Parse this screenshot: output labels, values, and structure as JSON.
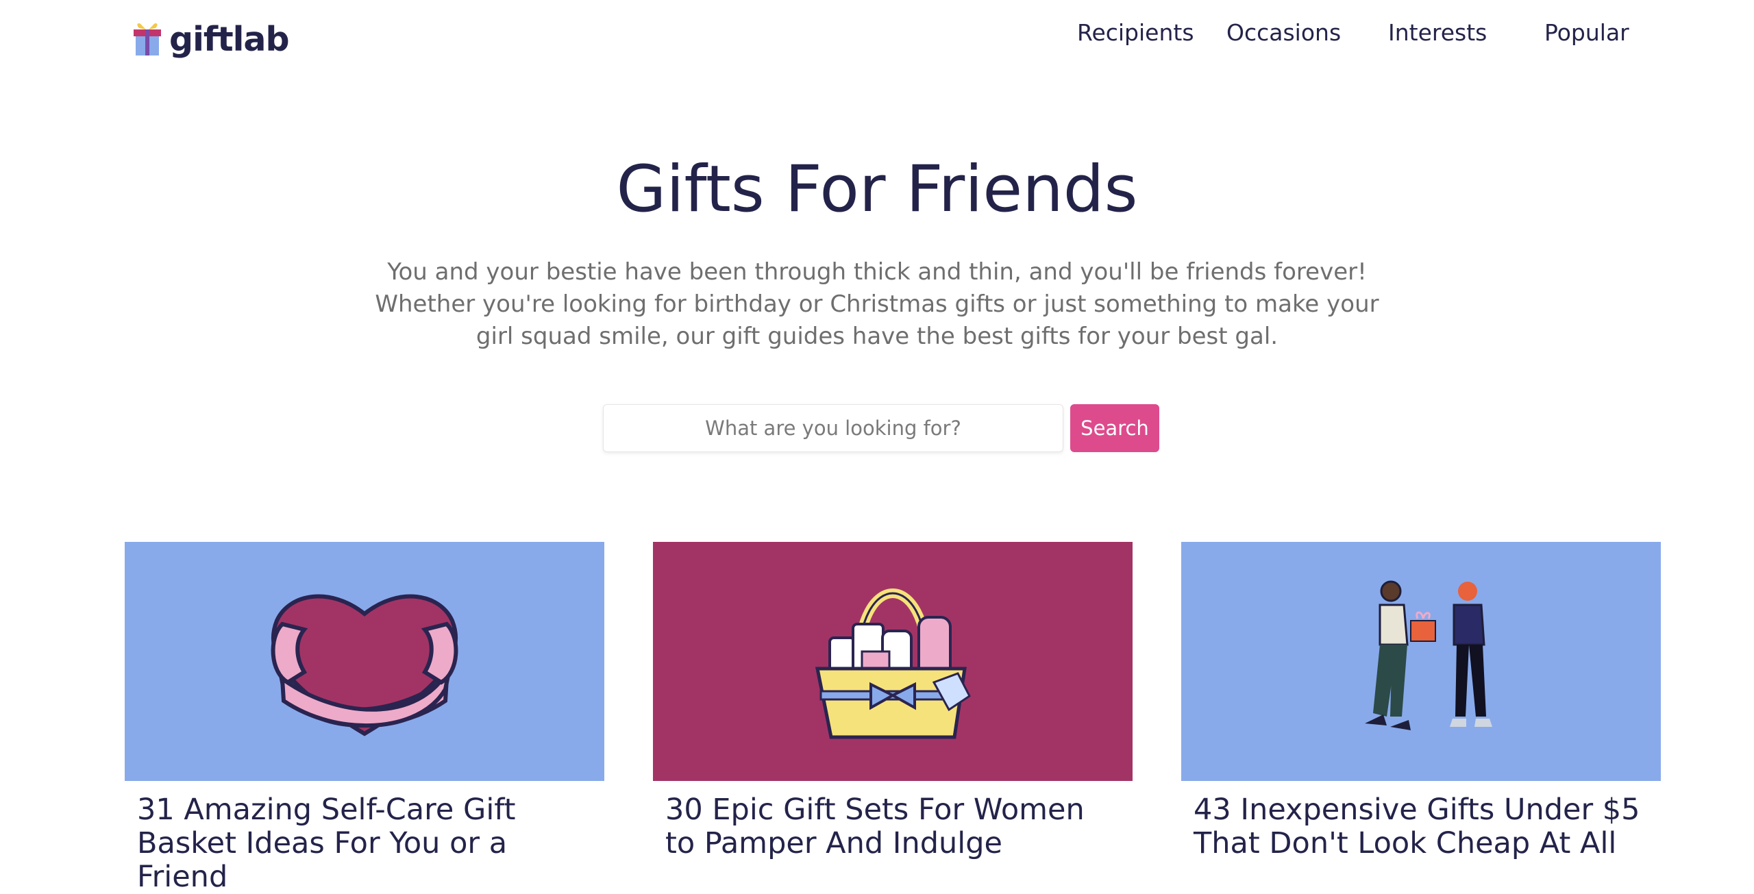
{
  "header": {
    "logo_text": "giftlab",
    "nav": {
      "recipients": "Recipients",
      "occasions": "Occasions",
      "interests": "Interests",
      "popular": "Popular"
    }
  },
  "hero": {
    "title": "Gifts For Friends",
    "description": "You and your bestie have been through thick and thin, and you'll be friends forever! Whether you're looking for birthday or Christmas gifts or just something to make your girl squad smile, our gift guides have the best gifts for your best gal."
  },
  "search": {
    "placeholder": "What are you looking for?",
    "button_label": "Search"
  },
  "cards": [
    {
      "title": "31 Amazing Self-Care Gift Basket Ideas For You or a Friend",
      "image": "heart-hug-icon",
      "bg_color": "#88aaeb"
    },
    {
      "title": "30 Epic Gift Sets For Women to Pamper And Indulge",
      "image": "gift-basket-icon",
      "bg_color": "#a23465"
    },
    {
      "title": "43 Inexpensive Gifts Under $5 That Don't Look Cheap At All",
      "image": "people-exchanging-gift-icon",
      "bg_color": "#88aaeb"
    }
  ],
  "colors": {
    "accent": "#dd4b8d",
    "text_dark": "#23234a",
    "text_muted": "#6e6e6e"
  }
}
